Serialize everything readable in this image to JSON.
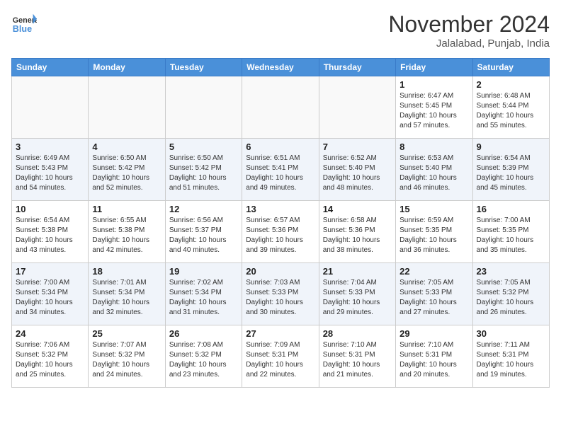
{
  "header": {
    "logo_line1": "General",
    "logo_line2": "Blue",
    "month": "November 2024",
    "location": "Jalalabad, Punjab, India"
  },
  "weekdays": [
    "Sunday",
    "Monday",
    "Tuesday",
    "Wednesday",
    "Thursday",
    "Friday",
    "Saturday"
  ],
  "weeks": [
    [
      {
        "day": "",
        "info": ""
      },
      {
        "day": "",
        "info": ""
      },
      {
        "day": "",
        "info": ""
      },
      {
        "day": "",
        "info": ""
      },
      {
        "day": "",
        "info": ""
      },
      {
        "day": "1",
        "info": "Sunrise: 6:47 AM\nSunset: 5:45 PM\nDaylight: 10 hours\nand 57 minutes."
      },
      {
        "day": "2",
        "info": "Sunrise: 6:48 AM\nSunset: 5:44 PM\nDaylight: 10 hours\nand 55 minutes."
      }
    ],
    [
      {
        "day": "3",
        "info": "Sunrise: 6:49 AM\nSunset: 5:43 PM\nDaylight: 10 hours\nand 54 minutes."
      },
      {
        "day": "4",
        "info": "Sunrise: 6:50 AM\nSunset: 5:42 PM\nDaylight: 10 hours\nand 52 minutes."
      },
      {
        "day": "5",
        "info": "Sunrise: 6:50 AM\nSunset: 5:42 PM\nDaylight: 10 hours\nand 51 minutes."
      },
      {
        "day": "6",
        "info": "Sunrise: 6:51 AM\nSunset: 5:41 PM\nDaylight: 10 hours\nand 49 minutes."
      },
      {
        "day": "7",
        "info": "Sunrise: 6:52 AM\nSunset: 5:40 PM\nDaylight: 10 hours\nand 48 minutes."
      },
      {
        "day": "8",
        "info": "Sunrise: 6:53 AM\nSunset: 5:40 PM\nDaylight: 10 hours\nand 46 minutes."
      },
      {
        "day": "9",
        "info": "Sunrise: 6:54 AM\nSunset: 5:39 PM\nDaylight: 10 hours\nand 45 minutes."
      }
    ],
    [
      {
        "day": "10",
        "info": "Sunrise: 6:54 AM\nSunset: 5:38 PM\nDaylight: 10 hours\nand 43 minutes."
      },
      {
        "day": "11",
        "info": "Sunrise: 6:55 AM\nSunset: 5:38 PM\nDaylight: 10 hours\nand 42 minutes."
      },
      {
        "day": "12",
        "info": "Sunrise: 6:56 AM\nSunset: 5:37 PM\nDaylight: 10 hours\nand 40 minutes."
      },
      {
        "day": "13",
        "info": "Sunrise: 6:57 AM\nSunset: 5:36 PM\nDaylight: 10 hours\nand 39 minutes."
      },
      {
        "day": "14",
        "info": "Sunrise: 6:58 AM\nSunset: 5:36 PM\nDaylight: 10 hours\nand 38 minutes."
      },
      {
        "day": "15",
        "info": "Sunrise: 6:59 AM\nSunset: 5:35 PM\nDaylight: 10 hours\nand 36 minutes."
      },
      {
        "day": "16",
        "info": "Sunrise: 7:00 AM\nSunset: 5:35 PM\nDaylight: 10 hours\nand 35 minutes."
      }
    ],
    [
      {
        "day": "17",
        "info": "Sunrise: 7:00 AM\nSunset: 5:34 PM\nDaylight: 10 hours\nand 34 minutes."
      },
      {
        "day": "18",
        "info": "Sunrise: 7:01 AM\nSunset: 5:34 PM\nDaylight: 10 hours\nand 32 minutes."
      },
      {
        "day": "19",
        "info": "Sunrise: 7:02 AM\nSunset: 5:34 PM\nDaylight: 10 hours\nand 31 minutes."
      },
      {
        "day": "20",
        "info": "Sunrise: 7:03 AM\nSunset: 5:33 PM\nDaylight: 10 hours\nand 30 minutes."
      },
      {
        "day": "21",
        "info": "Sunrise: 7:04 AM\nSunset: 5:33 PM\nDaylight: 10 hours\nand 29 minutes."
      },
      {
        "day": "22",
        "info": "Sunrise: 7:05 AM\nSunset: 5:33 PM\nDaylight: 10 hours\nand 27 minutes."
      },
      {
        "day": "23",
        "info": "Sunrise: 7:05 AM\nSunset: 5:32 PM\nDaylight: 10 hours\nand 26 minutes."
      }
    ],
    [
      {
        "day": "24",
        "info": "Sunrise: 7:06 AM\nSunset: 5:32 PM\nDaylight: 10 hours\nand 25 minutes."
      },
      {
        "day": "25",
        "info": "Sunrise: 7:07 AM\nSunset: 5:32 PM\nDaylight: 10 hours\nand 24 minutes."
      },
      {
        "day": "26",
        "info": "Sunrise: 7:08 AM\nSunset: 5:32 PM\nDaylight: 10 hours\nand 23 minutes."
      },
      {
        "day": "27",
        "info": "Sunrise: 7:09 AM\nSunset: 5:31 PM\nDaylight: 10 hours\nand 22 minutes."
      },
      {
        "day": "28",
        "info": "Sunrise: 7:10 AM\nSunset: 5:31 PM\nDaylight: 10 hours\nand 21 minutes."
      },
      {
        "day": "29",
        "info": "Sunrise: 7:10 AM\nSunset: 5:31 PM\nDaylight: 10 hours\nand 20 minutes."
      },
      {
        "day": "30",
        "info": "Sunrise: 7:11 AM\nSunset: 5:31 PM\nDaylight: 10 hours\nand 19 minutes."
      }
    ]
  ]
}
